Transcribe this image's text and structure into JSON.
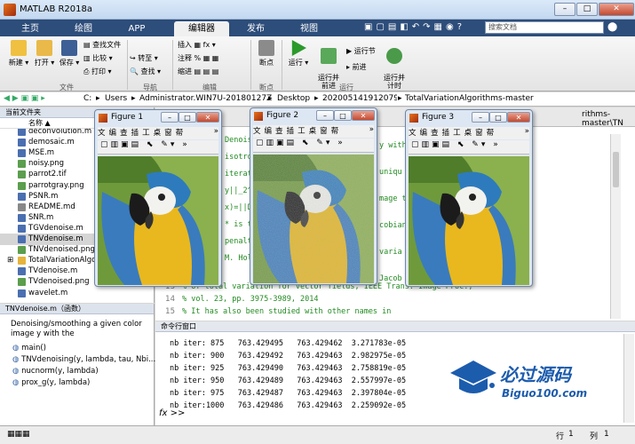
{
  "window": {
    "title": "MATLAB R2018a",
    "min": "–",
    "max": "□",
    "close": "✕"
  },
  "tabs": [
    "主页",
    "绘图",
    "APP",
    "编辑器",
    "发布",
    "视图"
  ],
  "search": {
    "placeholder": "搜索文档"
  },
  "toolstrip": {
    "new": "新建",
    "open": "打开",
    "save": "保存",
    "find_files": "查找文件",
    "compare": "比较",
    "print": "打印",
    "insert": "插入",
    "comment": "注释",
    "indent": "缩进",
    "goto": "转至",
    "find": "查找",
    "breakpoints": "断点",
    "run": "运行",
    "run_advance": "运行并\n前进",
    "run_section": "运行节",
    "advance": "前进",
    "run_time": "运行并\n计时",
    "groups": [
      "文件",
      "导航",
      "编辑",
      "断点",
      "运行"
    ]
  },
  "address": {
    "drive": "C:",
    "crumbs": [
      "Users",
      "Administrator.WIN7U-20180127Z",
      "Desktop",
      "20200514191207967​96",
      "TotalVariationAlgorithms-master"
    ]
  },
  "current_folder": {
    "title": "当前文件夹",
    "column": "名称",
    "files": [
      {
        "name": "deconvolution.m",
        "type": "m"
      },
      {
        "name": "demosaic.m",
        "type": "m"
      },
      {
        "name": "MSE.m",
        "type": "m"
      },
      {
        "name": "noisy.png",
        "type": "png"
      },
      {
        "name": "parrot2.tif",
        "type": "tif"
      },
      {
        "name": "parrotgray.png",
        "type": "png"
      },
      {
        "name": "PSNR.m",
        "type": "m"
      },
      {
        "name": "README.md",
        "type": "md"
      },
      {
        "name": "SNR.m",
        "type": "m"
      },
      {
        "name": "TGVdenoise.m",
        "type": "m"
      },
      {
        "name": "TNVdenoise.m",
        "type": "m",
        "selected": true
      },
      {
        "name": "TNVdenoised.png",
        "type": "png"
      },
      {
        "name": "TotalVariationAlgo",
        "type": "folder"
      },
      {
        "name": "TVdenoise.m",
        "type": "m"
      },
      {
        "name": "TVdenoised.png",
        "type": "png"
      },
      {
        "name": "wavelet.m",
        "type": "m"
      }
    ]
  },
  "details": {
    "title": "TNVdenoise.m（函数）",
    "desc": "Denoising/smoothing a given color image y with the",
    "functions": [
      "main()",
      "TNVdenoising(y, lambda, tau, Nbi...",
      "nucnorm(y, lambda)",
      "prox_g(y, lambda)"
    ]
  },
  "editor": {
    "path_tail": "rithms-master\\TN",
    "lines": [
      {
        "n": "",
        "t": "Denoising/smoothing"
      },
      {
        "n": "",
        "t": "isotropic"
      },
      {
        "n": "",
        "t": "iterative"
      },
      {
        "n": "",
        "t": "y||_2^2"
      },
      {
        "n": "",
        "t": "x)=||Dx||"
      },
      {
        "n": "",
        "t": "* is the"
      },
      {
        "n": "",
        "t": "penalty"
      },
      {
        "n": "",
        "t": "M. Holt"
      },
      {
        "n": "13",
        "t": "% of total variation for vector fields, IEEE Trans. Image Proc.,"
      },
      {
        "n": "14",
        "t": "% vol. 23, pp. 3975-3989, 2014"
      },
      {
        "n": "15",
        "t": "% It has also been studied with other names in"
      }
    ],
    "right_fragments": [
      "y with",
      "uniqu",
      "mage t",
      "cobian",
      "varia",
      "Jacob"
    ]
  },
  "command_window": {
    "title": "命令行窗口",
    "lines": [
      "nb iter: 875   763.429495   763.429462  3.271783e-05",
      "nb iter: 900   763.429492   763.429463  2.982975e-05",
      "nb iter: 925   763.429490   763.429463  2.758819e-05",
      "nb iter: 950   763.429489   763.429463  2.557997e-05",
      "nb iter: 975   763.429487   763.429463  2.397804e-05",
      "nb iter:1000   763.429486   763.429463  2.259092e-05"
    ],
    "prompt": "fx >>"
  },
  "figures": [
    {
      "title": "Figure 1"
    },
    {
      "title": "Figure 2"
    },
    {
      "title": "Figure 3"
    }
  ],
  "fig_menu": "文 编 查 插 工 桌 窗 帮",
  "status": {
    "row_label": "行",
    "row": "1",
    "col_label": "列",
    "col": "1"
  },
  "watermark": {
    "text": "必过源码",
    "url": "Biguo100.com"
  },
  "colors": {
    "tabbar": "#2d4d7a",
    "code_comment": "#228b22",
    "parrot_blue": "#3a7bbd",
    "parrot_yellow": "#e8b81e"
  }
}
